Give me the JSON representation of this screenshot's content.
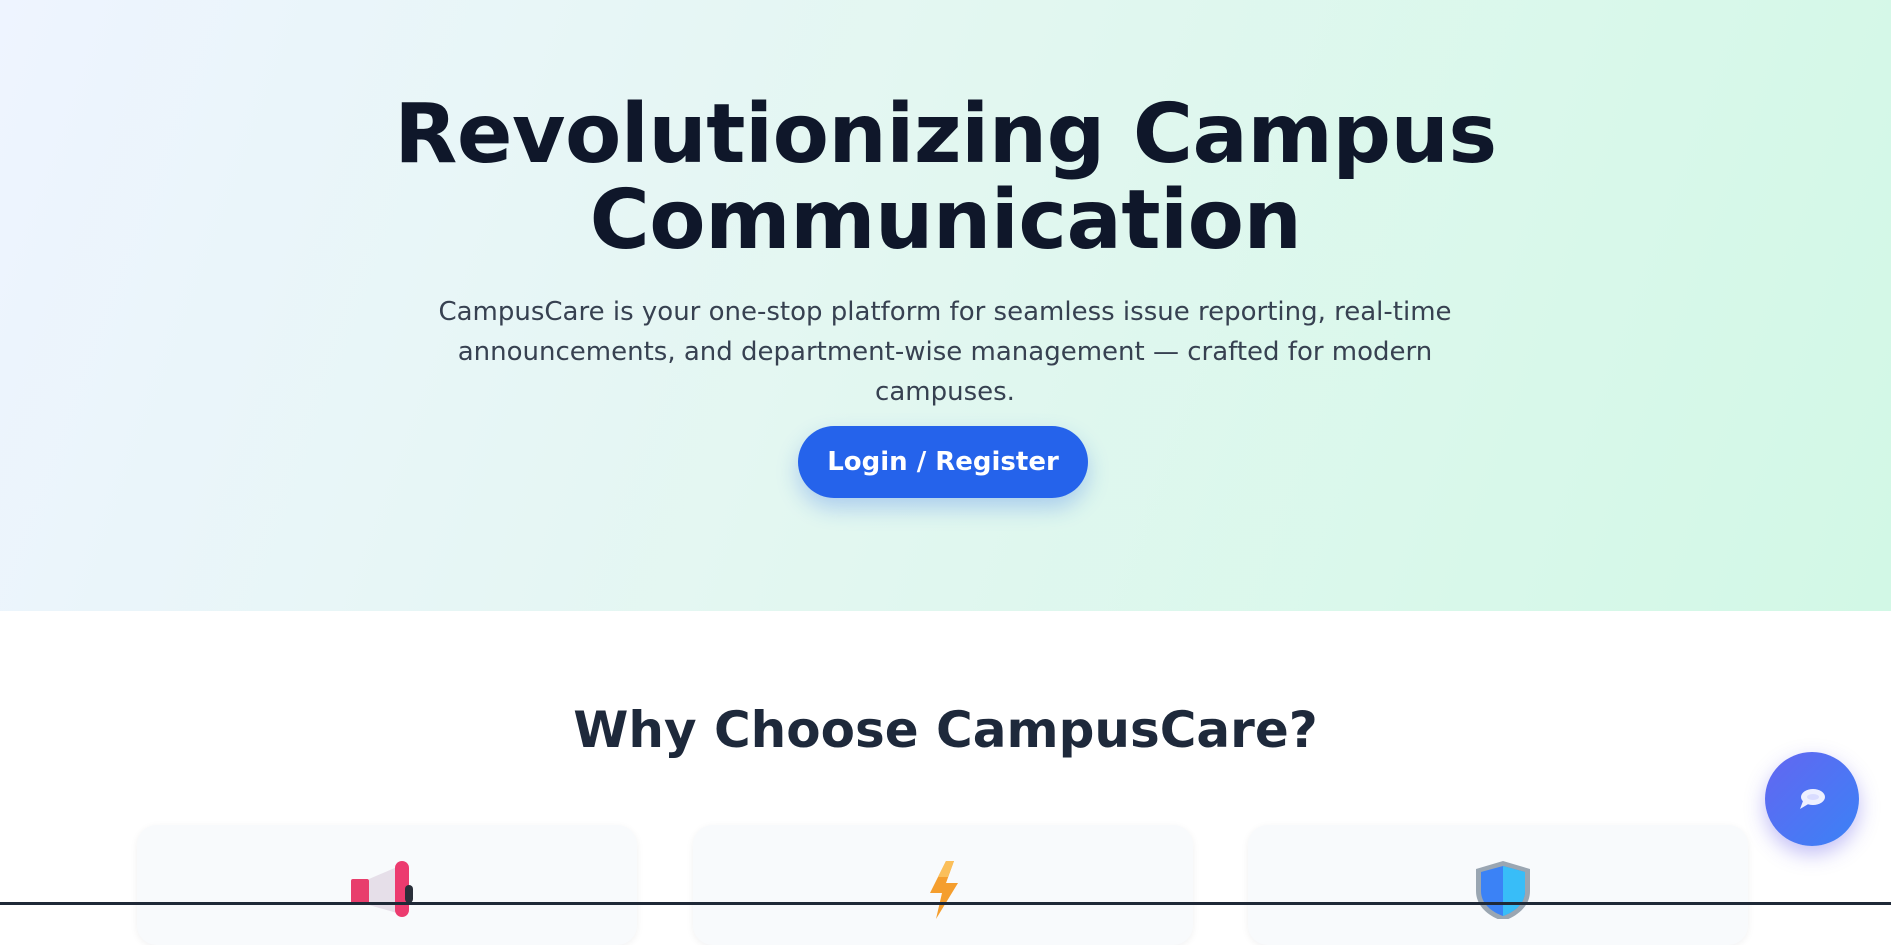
{
  "hero": {
    "title_line1": "Revolutionizing Campus",
    "title_line2": "Communication",
    "subtitle_line1": "CampusCare is your one-stop platform for seamless issue reporting, real-time",
    "subtitle_line2": "announcements, and department-wise management — crafted for modern campuses.",
    "cta_label": "Login / Register"
  },
  "features": {
    "title": "Why Choose CampusCare?",
    "cards": [
      {
        "icon": "megaphone-icon"
      },
      {
        "icon": "lightning-icon"
      },
      {
        "icon": "shield-icon"
      }
    ]
  },
  "chat_widget": {
    "icon": "chat-bubble-icon"
  },
  "colors": {
    "primary": "#2563eb",
    "heading": "#0f172a",
    "subheading": "#1e293b",
    "body_text": "#374151",
    "hero_gradient_start": "#eef4ff",
    "hero_gradient_end": "#d2f8e6",
    "card_background": "#f8fafc",
    "fab_gradient_start": "#6366f1",
    "fab_gradient_end": "#3b82f6"
  }
}
